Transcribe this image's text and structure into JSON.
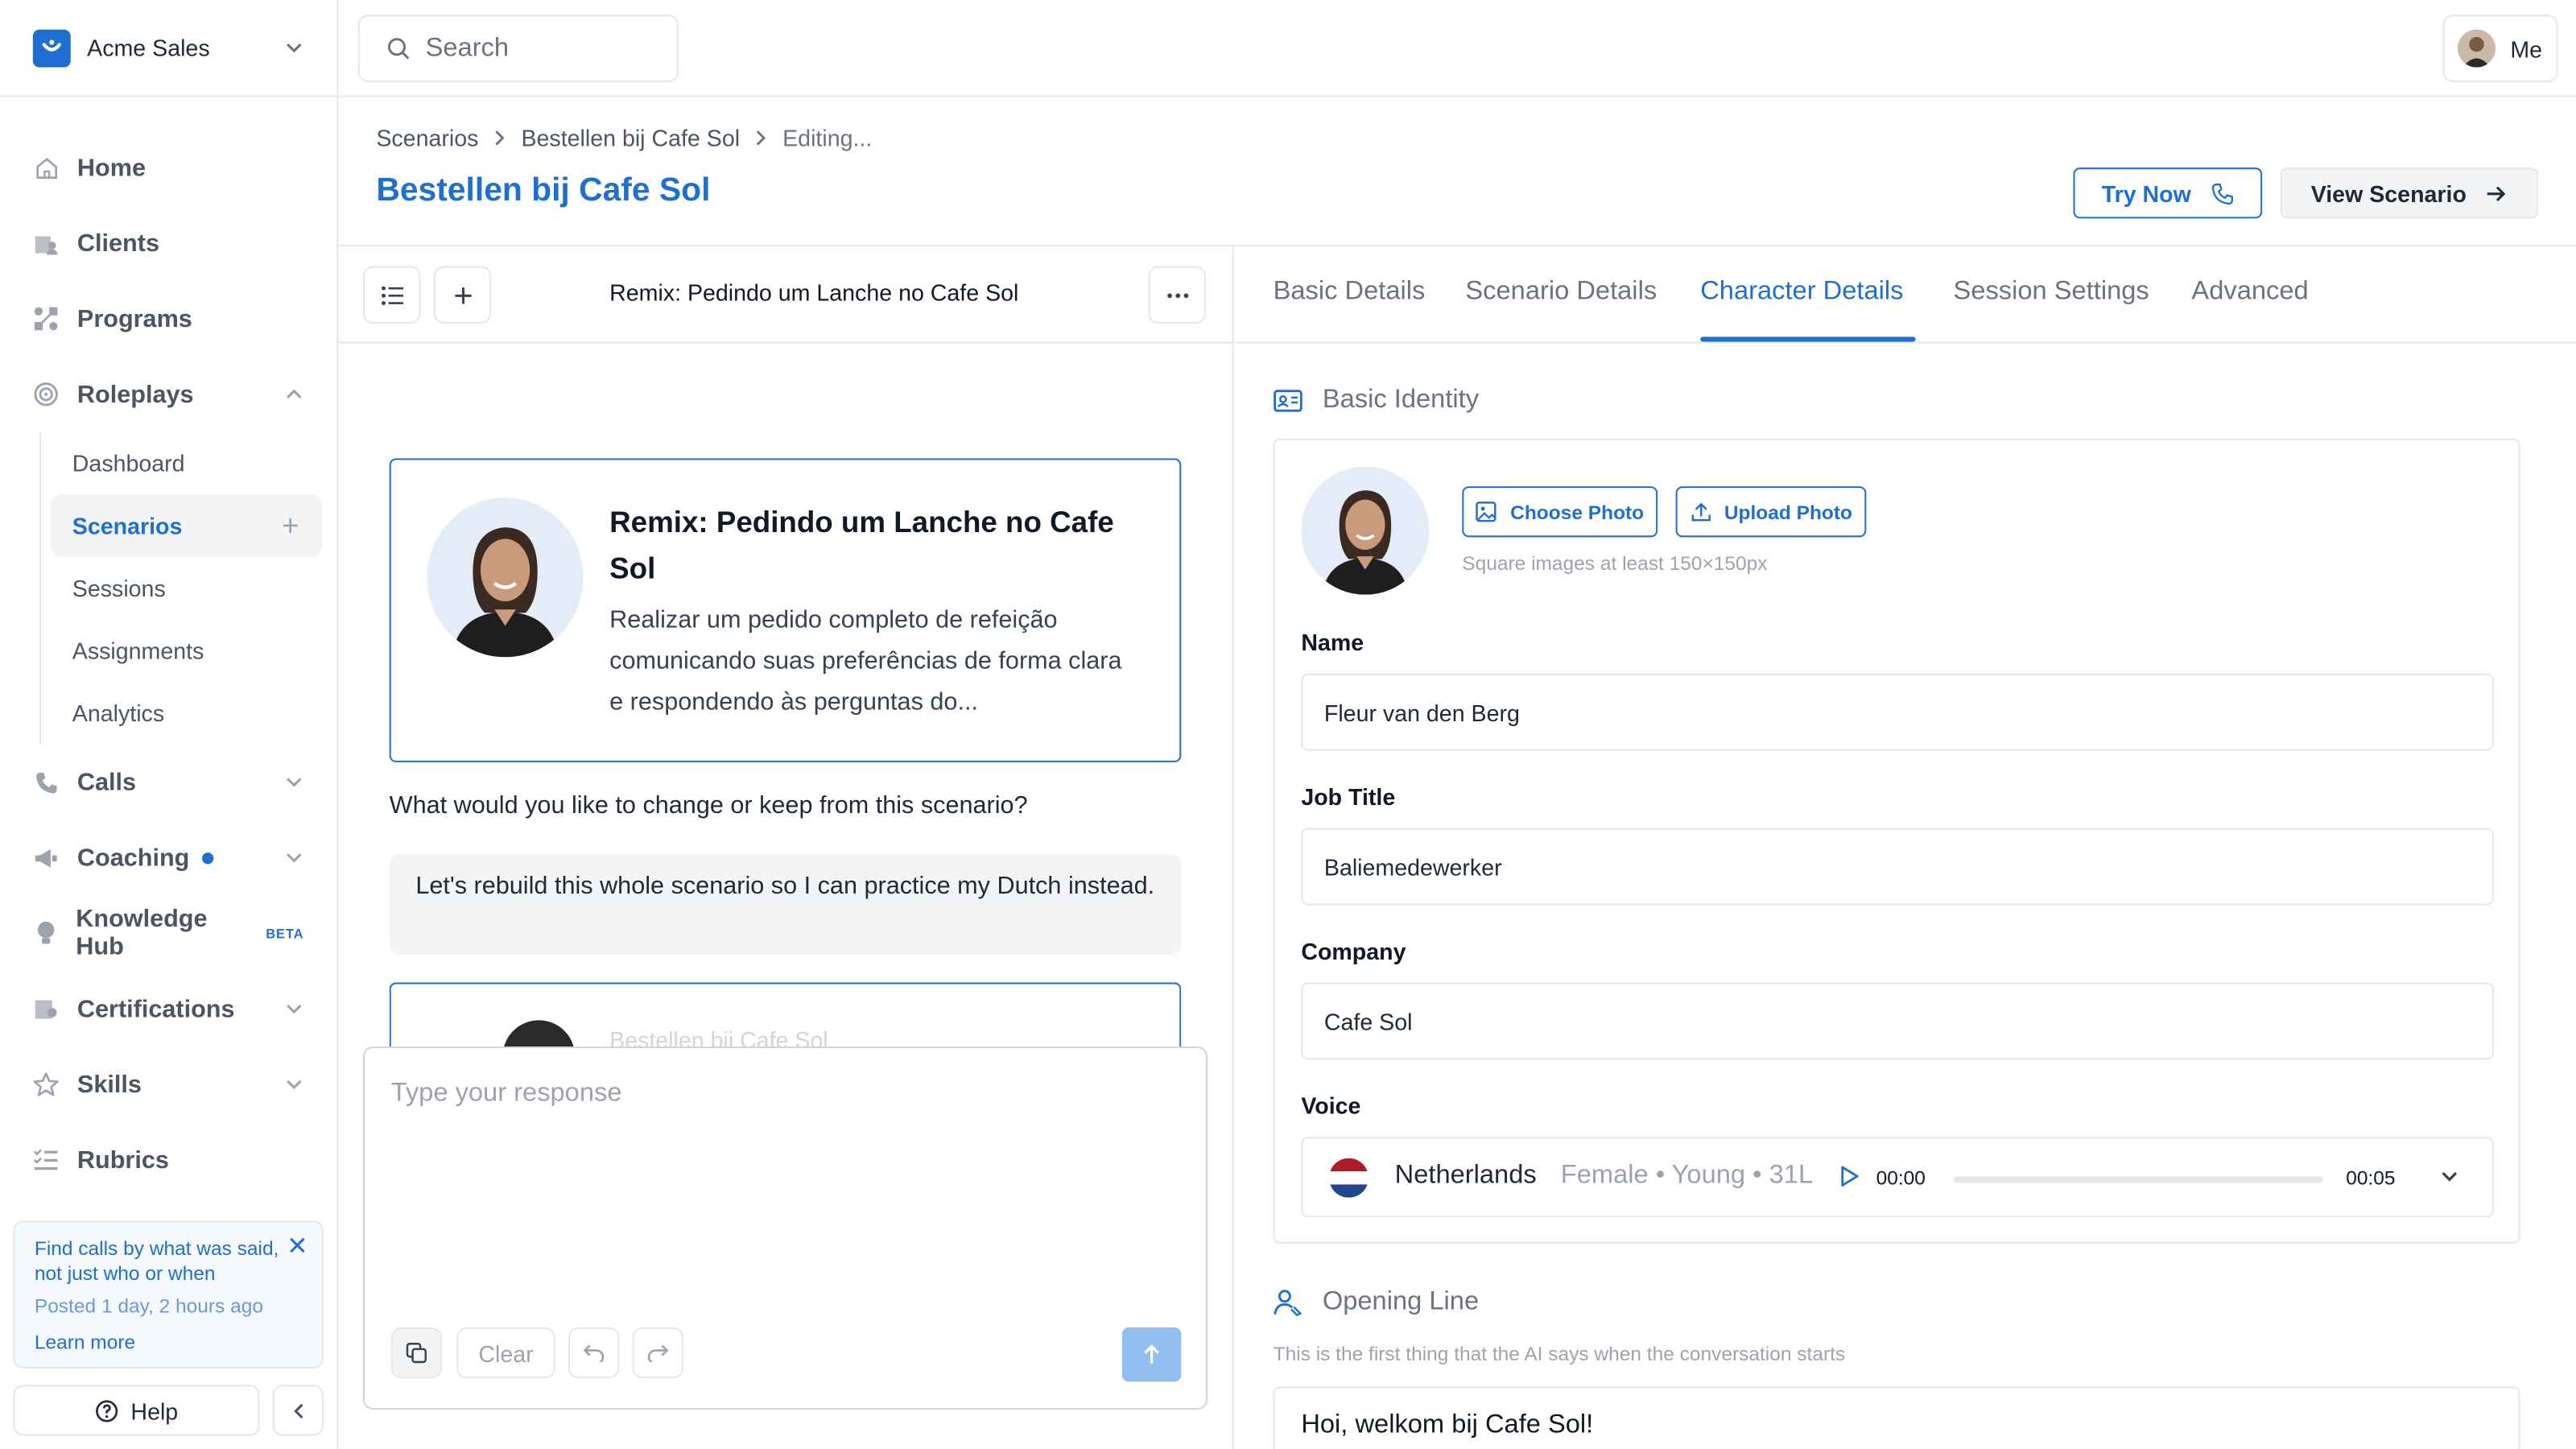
{
  "org": {
    "name": "Acme Sales"
  },
  "search": {
    "placeholder": "Search"
  },
  "user": {
    "label": "Me"
  },
  "nav": {
    "home": "Home",
    "clients": "Clients",
    "programs": "Programs",
    "roleplays": "Roleplays",
    "roleplays_sub": [
      "Dashboard",
      "Scenarios",
      "Sessions",
      "Assignments",
      "Analytics"
    ],
    "calls": "Calls",
    "coaching": "Coaching",
    "knowledge_hub": "Knowledge Hub",
    "knowledge_hub_badge": "BETA",
    "certifications": "Certifications",
    "skills": "Skills",
    "rubrics": "Rubrics"
  },
  "notice": {
    "text": "Find calls by what was said, not just who or when",
    "posted": "Posted 1 day, 2 hours ago",
    "link": "Learn more"
  },
  "help": {
    "label": "Help"
  },
  "breadcrumb": [
    "Scenarios",
    "Bestellen bij Cafe Sol",
    "Editing..."
  ],
  "page_title": "Bestellen bij Cafe Sol",
  "actions": {
    "try_now": "Try Now",
    "view_scenario": "View Scenario"
  },
  "chat": {
    "title": "Remix: Pedindo um Lanche no Cafe Sol",
    "card": {
      "title": "Remix: Pedindo um Lanche no Cafe Sol",
      "description": "Realizar um pedido completo de refeição comunicando suas preferências de forma clara e respondendo às perguntas do..."
    },
    "question": "What would you like to change or keep from this scenario?",
    "user_message": "Let's rebuild this whole scenario so I can practice my Dutch instead.",
    "second_card_faint": "Bestellen bij Cafe Sol",
    "composer_placeholder": "Type your response",
    "clear_label": "Clear"
  },
  "tabs": [
    "Basic Details",
    "Scenario Details",
    "Character Details",
    "Session Settings",
    "Advanced"
  ],
  "active_tab": "Character Details",
  "identity": {
    "section_title": "Basic Identity",
    "choose_photo": "Choose Photo",
    "upload_photo": "Upload Photo",
    "photo_hint": "Square images at least 150×150px",
    "name_label": "Name",
    "name_value": "Fleur van den Berg",
    "job_label": "Job Title",
    "job_value": "Baliemedewerker",
    "company_label": "Company",
    "company_value": "Cafe Sol",
    "voice_label": "Voice",
    "voice": {
      "country": "Netherlands",
      "meta": "Female • Young • 31L",
      "current_time": "00:00",
      "duration": "00:05",
      "progress": 0
    }
  },
  "opening": {
    "section_title": "Opening Line",
    "subtitle": "This is the first thing that the AI says when the conversation starts",
    "value": "Hoi, welkom bij Cafe Sol!"
  },
  "colors": {
    "accent": "#1f6fd1",
    "send_disabled": "#93bff0"
  }
}
